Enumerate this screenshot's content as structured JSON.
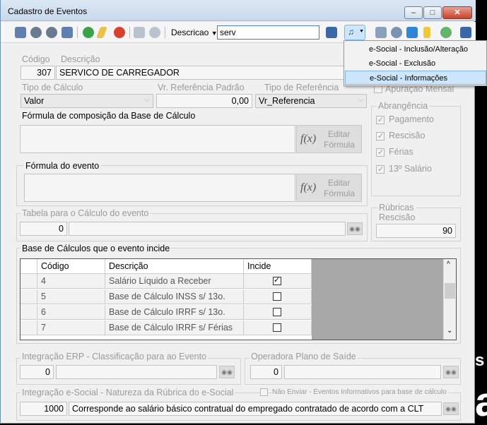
{
  "window": {
    "title": "Cadastro de Eventos",
    "min": "–",
    "max": "□",
    "close": "✕"
  },
  "toolbar": {
    "search_field_label": "Descricao",
    "search_value": "serv"
  },
  "menu": {
    "items": [
      "e-Social - Inclusão/Alteração",
      "e-Social - Exclusão",
      "e-Social - Informações"
    ],
    "selected": "e-Social - Informações"
  },
  "form": {
    "codigo_label": "Código",
    "descricao_label": "Descrição",
    "codigo": "307",
    "descricao": "SERVICO DE CARREGADOR",
    "tipo_calculo_label": "Tipo de Cálculo",
    "tipo_calculo": "Valor",
    "vr_ref_label": "Vr. Referência Padrão",
    "vr_ref": "0,00",
    "tipo_ref_label": "Tipo de Referência",
    "tipo_ref": "Vr_Referencia",
    "apuracao_label": "Apuração Mensal",
    "formula_base_label": "Fórmula de composição da Base de Cálculo",
    "formula_evento_label": "Fórmula do evento",
    "fx": "f(x)",
    "editar": "Editar",
    "formula": "Fórmula",
    "abrangencia_label": "Abrangência",
    "abrangencia": [
      "Pagamento",
      "Rescisão",
      "Férias",
      "13º Salário"
    ],
    "tabela_label": "Tabela para o Cálculo do evento",
    "tabela_value": "0",
    "rubricas_label1": "Rúbricas",
    "rubricas_label2": "Rescisão",
    "rubricas_value": "90",
    "base_label": "Base de Cálculos que o evento incide",
    "integracao_erp_label": "Integração ERP - Classificação para ao Evento",
    "integracao_erp_value": "0",
    "operadora_label": "Operadora Plano de Saíde",
    "operadora_value": "0",
    "esocial_label": "Integração e-Social - Natureza da Rúbrica do e-Social",
    "nao_enviar_label": "Não Enviar - Eventos Informativos para base de cálculo",
    "esocial_code": "1000",
    "esocial_desc": "Corresponde ao salário básico contratual do empregado contratado de acordo com a CLT"
  },
  "grid": {
    "headers": [
      "Código",
      "Descrição",
      "Incide"
    ],
    "rows": [
      {
        "codigo": "4",
        "descricao": "Salário Líquido a Receber",
        "incide": true
      },
      {
        "codigo": "5",
        "descricao": "Base de Cálculo INSS s/ 13o.",
        "incide": false
      },
      {
        "codigo": "6",
        "descricao": "Base de Cálculo IRRF s/ 13o.",
        "incide": false
      },
      {
        "codigo": "7",
        "descricao": "Base de Cálculo IRRF s/ Férias",
        "incide": false
      }
    ]
  },
  "background": {
    "text1": "s",
    "text2": "a"
  }
}
